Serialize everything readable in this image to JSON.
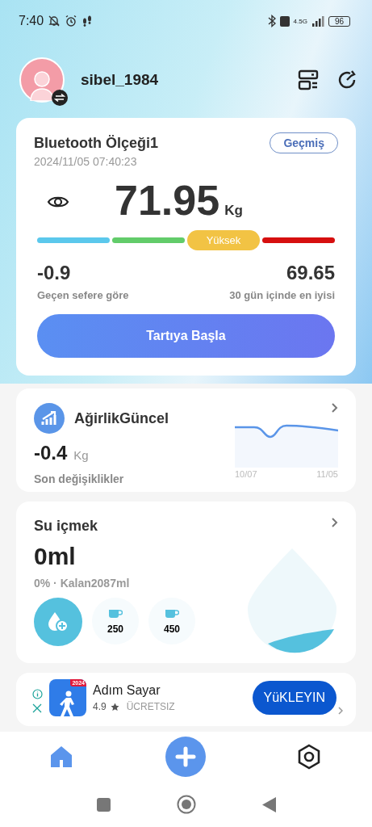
{
  "status_bar": {
    "time": "7:40",
    "network": "4.5G",
    "battery": "96"
  },
  "header": {
    "username": "sibel_1984"
  },
  "scale_card": {
    "title": "Bluetooth Ölçeği1",
    "history_button": "Geçmiş",
    "timestamp": "2024/11/05 07:40:23",
    "weight": "71.95",
    "unit": "Kg",
    "segments": [
      {
        "color": "#5bc8ec",
        "selected": false
      },
      {
        "color": "#62cc6a",
        "selected": false
      },
      {
        "color": "#f2c344",
        "selected": true,
        "label": "Yüksek"
      },
      {
        "color": "#d60f0f",
        "selected": false
      }
    ],
    "change_value": "-0.9",
    "change_label": "Geçen sefere göre",
    "best_value": "69.65",
    "best_label": "30 gün içinde en iyisi",
    "start_button": "Tartıya Başla"
  },
  "weight_card": {
    "title": "AğirlikGüncel",
    "value": "-0.4",
    "unit": "Kg",
    "caption": "Son değişiklikler",
    "x_start": "10/07",
    "x_end": "11/05"
  },
  "water_card": {
    "title": "Su içmek",
    "amount": "0ml",
    "summary": "0% · Kalan2087ml",
    "cups": [
      {
        "amount": "250"
      },
      {
        "amount": "450"
      }
    ]
  },
  "ad": {
    "badge": "2024",
    "name": "Adım Sayar",
    "rating": "4.9",
    "price": "ÜCRETSIZ",
    "install_button": "YüKLEYIN"
  },
  "bottom_nav": [
    {
      "kind": "home",
      "selected": true
    },
    {
      "kind": "add",
      "selected": false
    },
    {
      "kind": "settings",
      "selected": false
    }
  ]
}
